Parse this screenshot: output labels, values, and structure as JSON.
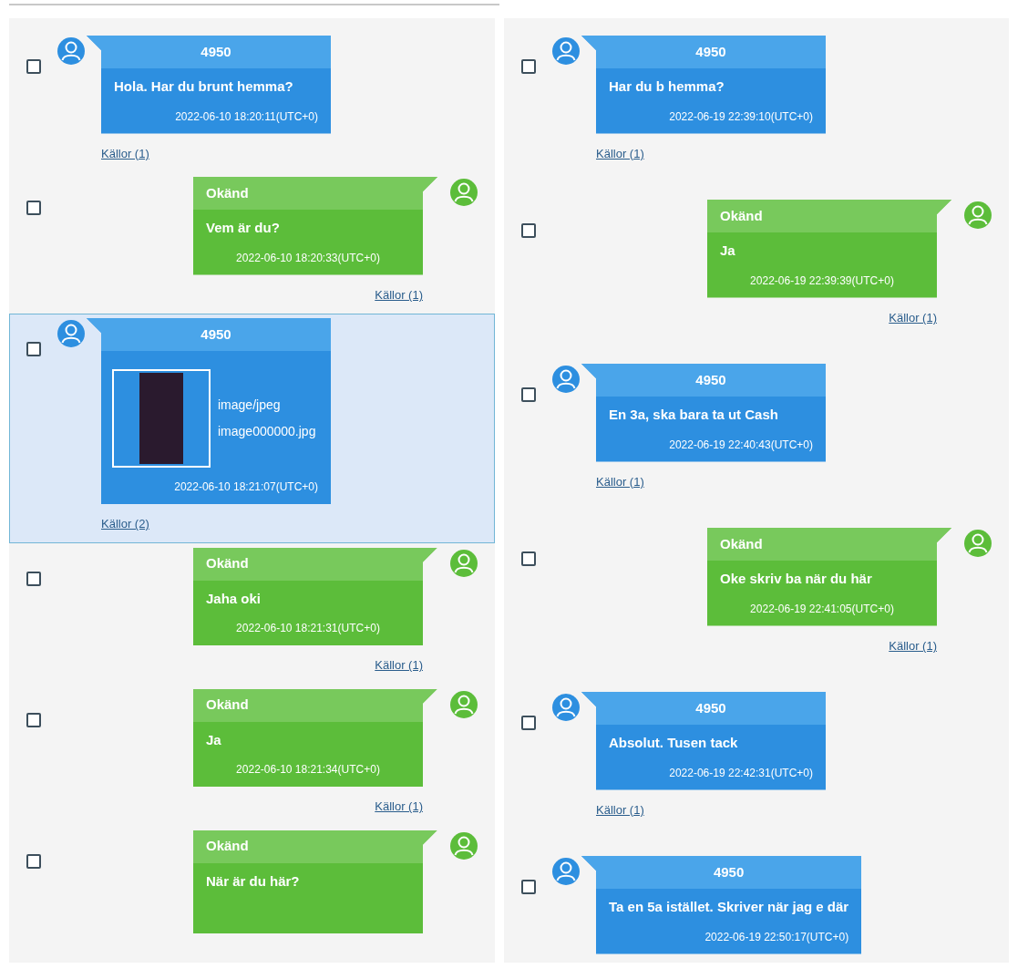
{
  "columns": [
    {
      "messages": [
        {
          "kind": "incoming",
          "sender": "4950",
          "text": "Hola. Har du brunt hemma?",
          "timestamp": "2022-06-10 18:20:11(UTC+0)",
          "sources": "Källor (1)",
          "checked": false,
          "selected": false
        },
        {
          "kind": "outgoing",
          "sender": "Okänd",
          "text": "Vem är du?",
          "timestamp": "2022-06-10 18:20:33(UTC+0)",
          "sources": "Källor (1)",
          "checked": false,
          "selected": false
        },
        {
          "kind": "incoming",
          "sender": "4950",
          "attachment": {
            "mime": "image/jpeg",
            "filename": "image000000.jpg"
          },
          "timestamp": "2022-06-10 18:21:07(UTC+0)",
          "sources": "Källor (2)",
          "checked": false,
          "selected": true
        },
        {
          "kind": "outgoing",
          "sender": "Okänd",
          "text": "Jaha oki",
          "timestamp": "2022-06-10 18:21:31(UTC+0)",
          "sources": "Källor (1)",
          "checked": false,
          "selected": false
        },
        {
          "kind": "outgoing",
          "sender": "Okänd",
          "text": "Ja",
          "timestamp": "2022-06-10 18:21:34(UTC+0)",
          "sources": "Källor (1)",
          "checked": false,
          "selected": false
        },
        {
          "kind": "outgoing",
          "sender": "Okänd",
          "text": "När är du här?",
          "checked": false,
          "selected": false
        }
      ]
    },
    {
      "messages": [
        {
          "kind": "incoming",
          "sender": "4950",
          "text": "Har du b hemma?",
          "timestamp": "2022-06-19 22:39:10(UTC+0)",
          "sources": "Källor (1)",
          "checked": false,
          "selected": false
        },
        {
          "kind": "outgoing",
          "sender": "Okänd",
          "text": "Ja",
          "timestamp": "2022-06-19 22:39:39(UTC+0)",
          "sources": "Källor (1)",
          "checked": false,
          "selected": false
        },
        {
          "kind": "incoming",
          "sender": "4950",
          "text": "En 3a, ska bara ta ut Cash",
          "timestamp": "2022-06-19 22:40:43(UTC+0)",
          "sources": "Källor (1)",
          "checked": false,
          "selected": false
        },
        {
          "kind": "outgoing",
          "sender": "Okänd",
          "text": "Oke skriv ba när du här",
          "timestamp": "2022-06-19 22:41:05(UTC+0)",
          "sources": "Källor (1)",
          "checked": false,
          "selected": false
        },
        {
          "kind": "incoming",
          "sender": "4950",
          "text": "Absolut. Tusen tack",
          "timestamp": "2022-06-19 22:42:31(UTC+0)",
          "sources": "Källor (1)",
          "checked": false,
          "selected": false
        },
        {
          "kind": "incoming",
          "sender": "4950",
          "text": "Ta en 5a istället. Skriver när jag e där",
          "timestamp": "2022-06-19 22:50:17(UTC+0)",
          "checked": false,
          "selected": false
        }
      ]
    }
  ]
}
